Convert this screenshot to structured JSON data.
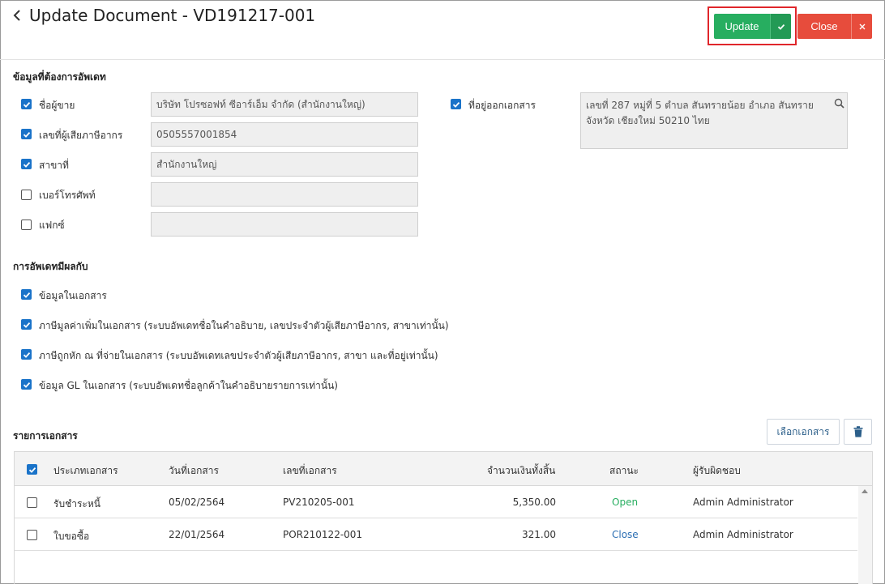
{
  "header": {
    "title": "Update Document - VD191217-001",
    "update_label": "Update",
    "close_label": "Close"
  },
  "update_section": {
    "title": "ข้อมูลที่ต้องการอัพเดท",
    "fields": [
      {
        "label": "ชื่อผู้ขาย",
        "value": "บริษัท โปรซอฟท์ ซีอาร์เอ็ม จำกัด (สำนักงานใหญ่)",
        "checked": true
      },
      {
        "label": "เลขที่ผู้เสียภาษีอากร",
        "value": "0505557001854",
        "checked": true
      },
      {
        "label": "สาขาที่",
        "value": "สำนักงานใหญ่",
        "checked": true
      },
      {
        "label": "เบอร์โทรศัพท์",
        "value": "",
        "checked": false
      },
      {
        "label": "แฟกซ์",
        "value": "",
        "checked": false
      }
    ],
    "address": {
      "label": "ที่อยู่ออกเอกสาร",
      "value": "เลขที่ 287 หมู่ที่ 5 ตำบล สันทรายน้อย อำเภอ สันทราย จังหวัด เชียงใหม่ 50210 ไทย",
      "checked": true
    }
  },
  "effect_section": {
    "title": "การอัพเดทมีผลกับ",
    "options": [
      {
        "label": "ข้อมูลในเอกสาร",
        "checked": true
      },
      {
        "label": "ภาษีมูลค่าเพิ่มในเอกสาร  (ระบบอัพเดทชื่อในคำอธิบาย, เลขประจำตัวผู้เสียภาษีอากร, สาขาเท่านั้น)",
        "checked": true
      },
      {
        "label": "ภาษีถูกหัก ณ ที่จ่ายในเอกสาร  (ระบบอัพเดทเลขประจำตัวผู้เสียภาษีอากร, สาขา และที่อยู่เท่านั้น)",
        "checked": true
      },
      {
        "label": "ข้อมูล GL ในเอกสาร  (ระบบอัพเดทชื่อลูกค้าในคำอธิบายรายการเท่านั้น)",
        "checked": true
      }
    ]
  },
  "documents": {
    "title": "รายการเอกสาร",
    "select_label": "เลือกเอกสาร",
    "columns": [
      "ประเภทเอกสาร",
      "วันที่เอกสาร",
      "เลขที่เอกสาร",
      "จำนวนเงินทั้งสิ้น",
      "สถานะ",
      "ผู้รับผิดชอบ"
    ],
    "rows": [
      {
        "type": "รับชำระหนี้",
        "date": "05/02/2564",
        "number": "PV210205-001",
        "amount": "5,350.00",
        "status": "Open",
        "owner": "Admin Administrator"
      },
      {
        "type": "ใบขอซื้อ",
        "date": "22/01/2564",
        "number": "POR210122-001",
        "amount": "321.00",
        "status": "Close",
        "owner": "Admin Administrator"
      }
    ]
  },
  "colors": {
    "accent_green": "#27ae60",
    "danger_red": "#e74c3c",
    "checkbox_blue": "#1a73c9",
    "highlight_red": "#e0262b"
  },
  "icons": [
    "back-icon",
    "check-icon",
    "close-icon",
    "search-icon",
    "trash-icon"
  ]
}
